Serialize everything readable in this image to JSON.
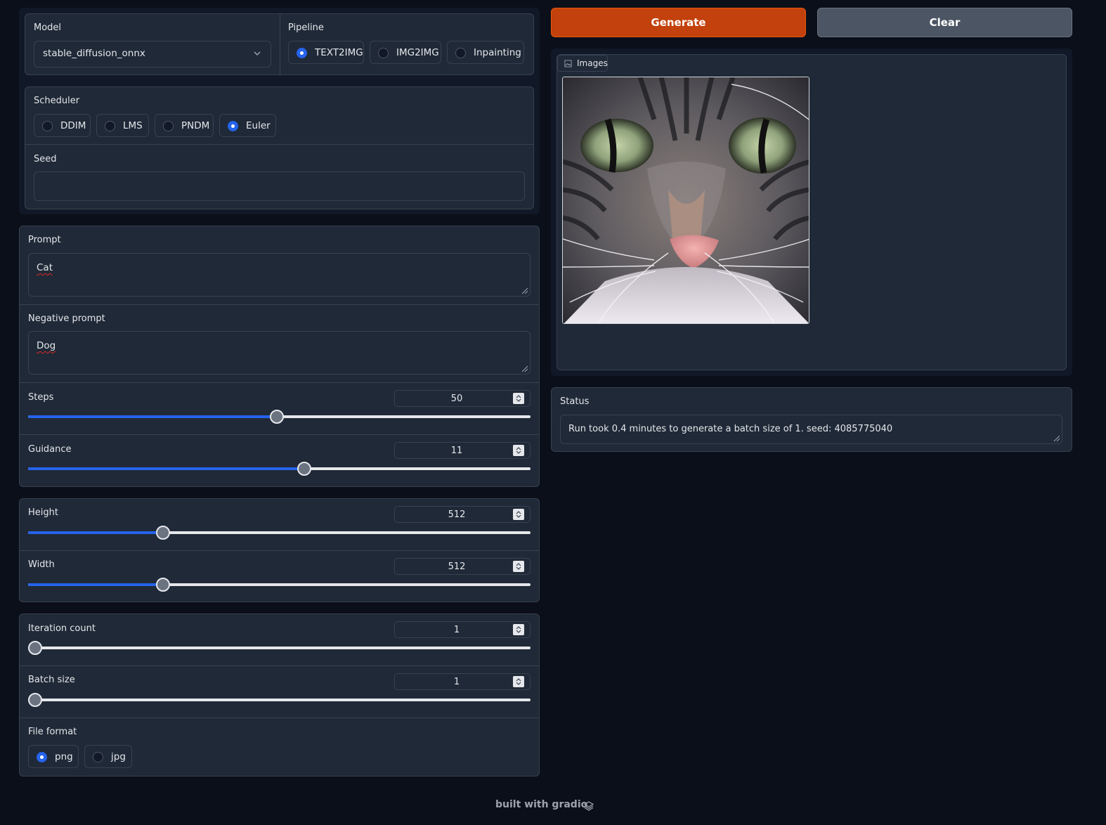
{
  "model": {
    "label": "Model",
    "value": "stable_diffusion_onnx"
  },
  "pipeline": {
    "label": "Pipeline",
    "options": [
      "TEXT2IMG",
      "IMG2IMG",
      "Inpainting"
    ],
    "selected": "TEXT2IMG"
  },
  "scheduler": {
    "label": "Scheduler",
    "options": [
      "DDIM",
      "LMS",
      "PNDM",
      "Euler"
    ],
    "selected": "Euler"
  },
  "seed": {
    "label": "Seed",
    "value": ""
  },
  "prompt": {
    "label": "Prompt",
    "value": "Cat"
  },
  "negative_prompt": {
    "label": "Negative prompt",
    "value": "Dog"
  },
  "steps": {
    "label": "Steps",
    "value": "50",
    "fraction": 0.495
  },
  "guidance": {
    "label": "Guidance",
    "value": "11",
    "fraction": 0.549
  },
  "height": {
    "label": "Height",
    "value": "512",
    "fraction": 0.268
  },
  "width": {
    "label": "Width",
    "value": "512",
    "fraction": 0.268
  },
  "iteration_count": {
    "label": "Iteration count",
    "value": "1",
    "fraction": 0
  },
  "batch_size": {
    "label": "Batch size",
    "value": "1",
    "fraction": 0
  },
  "file_format": {
    "label": "File format",
    "options": [
      "png",
      "jpg"
    ],
    "selected": "png"
  },
  "buttons": {
    "generate": "Generate",
    "clear": "Clear"
  },
  "gallery": {
    "label": "Images"
  },
  "status": {
    "label": "Status",
    "value": "Run took 0.4 minutes to generate a batch size of 1. seed: 4085775040"
  },
  "footer": {
    "text": "built with gradio"
  },
  "colors": {
    "accent": "#2563eb",
    "generate": "#c2410c",
    "background": "#0b0f19",
    "panel": "#1f2937"
  }
}
